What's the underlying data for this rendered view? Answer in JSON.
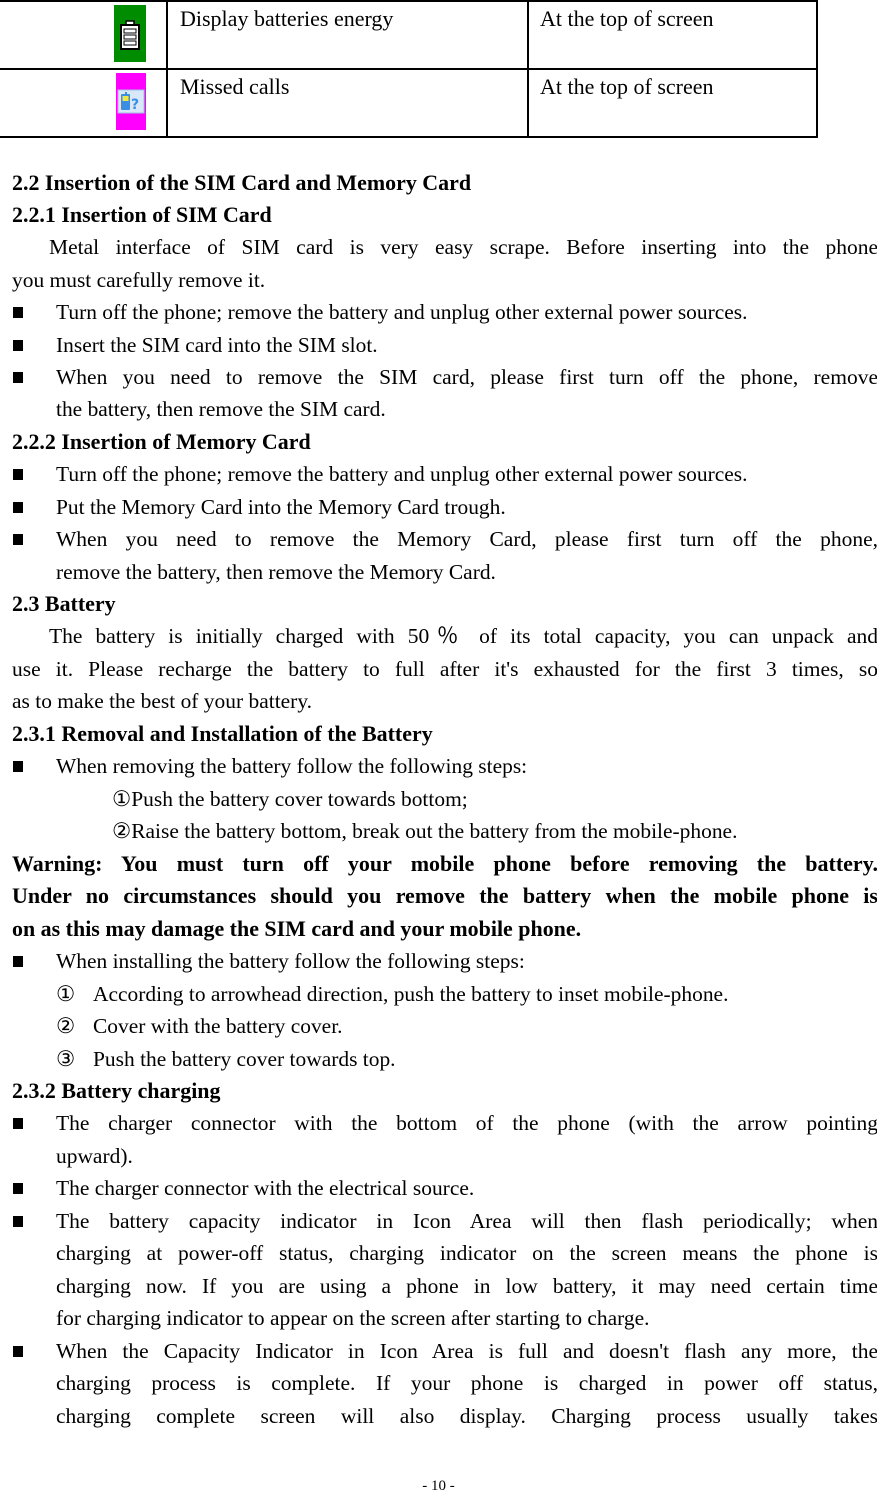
{
  "table": {
    "rows": [
      {
        "icon": "battery-level-icon",
        "icon_color": "#008c00",
        "description": "Display batteries energy",
        "position": "At the top of screen"
      },
      {
        "icon": "missed-call-icon",
        "icon_color": "#ff00ff",
        "description": "Missed calls",
        "position": "At the top of screen"
      }
    ]
  },
  "sections": {
    "s2_2": {
      "heading": "2.2 Insertion of the SIM Card and Memory Card"
    },
    "s2_2_1": {
      "heading": "2.2.1 Insertion of SIM Card",
      "intro": [
        "Metal interface of SIM card is very easy scrape. Before inserting into the phone",
        "you must carefully remove it."
      ],
      "bullets": [
        [
          "Turn off the phone; remove the battery and unplug other external power sources."
        ],
        [
          "Insert the SIM card into the SIM slot."
        ],
        [
          "When you need to remove the SIM card, please first turn off the phone, remove",
          "the battery, then remove the SIM card."
        ]
      ]
    },
    "s2_2_2": {
      "heading": "2.2.2 Insertion of Memory Card",
      "bullets": [
        [
          "Turn off the phone; remove the battery and unplug other external power sources."
        ],
        [
          "Put the Memory Card into the Memory Card trough."
        ],
        [
          "When you need to remove the Memory Card, please first turn off the phone,",
          "remove the battery, then remove the Memory Card."
        ]
      ]
    },
    "s2_3": {
      "heading": "2.3 Battery",
      "intro": [
        "The battery is initially charged with 50％ of its total capacity, you can unpack and",
        "use it.    Please recharge the battery to full after it's exhausted for the first 3 times, so",
        "as to make the best of your battery."
      ]
    },
    "s2_3_1": {
      "heading": "2.3.1 Removal and Installation of the Battery",
      "removing_bullet": "When removing the battery follow the following steps:",
      "removing_steps": [
        "①Push the battery cover towards bottom;",
        "②Raise the battery bottom, break out the battery from the mobile-phone."
      ],
      "warning": [
        "Warning: You must turn off your mobile phone before removing the battery.",
        "Under no circumstances should you remove the battery when the mobile phone is",
        "on as this may damage the SIM card and your mobile phone."
      ],
      "installing_bullet": "When installing the battery follow the following steps:",
      "installing_steps": [
        {
          "num": "①",
          "text": "According to arrowhead direction, push the battery to inset mobile-phone."
        },
        {
          "num": "②",
          "text": "Cover with the battery cover."
        },
        {
          "num": "③",
          "text": "Push the battery cover towards top."
        }
      ]
    },
    "s2_3_2": {
      "heading": "2.3.2 Battery charging",
      "bullets": [
        [
          "The charger connector with the bottom of the phone (with the arrow pointing",
          "upward)."
        ],
        [
          "The charger connector with the electrical source."
        ],
        [
          "The battery capacity indicator in Icon Area will then flash periodically; when",
          "charging at power-off status, charging indicator on the screen means the phone is",
          "charging now. If you are using a phone in low battery, it may need certain time",
          "for charging indicator to appear on the screen after starting to charge."
        ],
        [
          "When the Capacity Indicator in Icon Area is full and doesn't flash any more, the",
          "charging process is complete. If your phone is charged in power off status,",
          "charging complete screen will also display.  Charging process usually takes"
        ]
      ]
    }
  },
  "footer": {
    "page_number": "- 10 -"
  }
}
